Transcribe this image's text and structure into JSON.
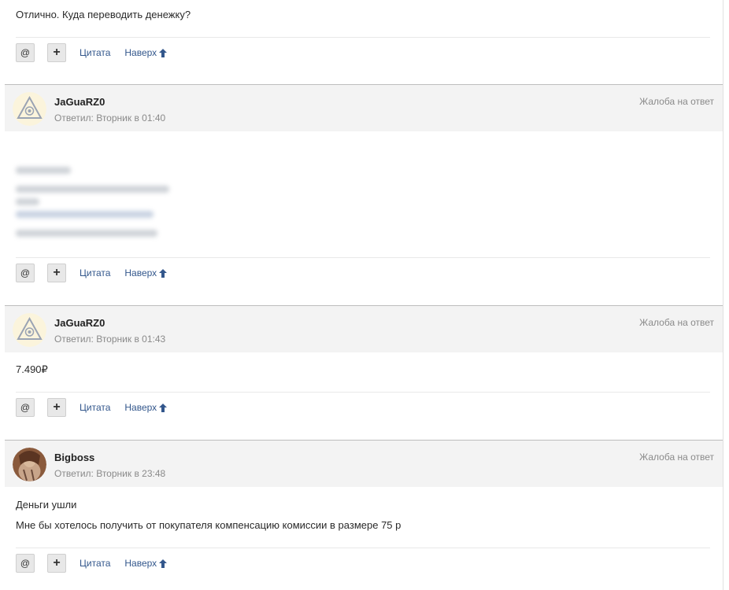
{
  "thread": {
    "top_message": "Отлично. Куда переводить денежку?",
    "posts": [
      {
        "author": "JaGuaRZ0",
        "meta": "Ответил: Вторник в 01:40",
        "report": "Жалоба на ответ",
        "avatar_icon": "triangle-eye-icon",
        "body": []
      },
      {
        "author": "JaGuaRZ0",
        "meta": "Ответил: Вторник в 01:43",
        "report": "Жалоба на ответ",
        "avatar_icon": "triangle-eye-icon",
        "body": [
          "7.490₽"
        ]
      },
      {
        "author": "Bigboss",
        "meta": "Ответил: Вторник в 23:48",
        "report": "Жалоба на ответ",
        "avatar_icon": "user-photo",
        "body": [
          "Деньги ушли",
          "Мне бы хотелось получить от покупателя компенсацию комиссии в размере 75 р"
        ]
      }
    ]
  },
  "actions": {
    "mention": "@",
    "plus": "+",
    "quote": "Цитата",
    "top": "Наверх"
  },
  "colors": {
    "link": "#33578c",
    "header_bg": "#f3f3f3",
    "muted": "#8a8a8a"
  }
}
